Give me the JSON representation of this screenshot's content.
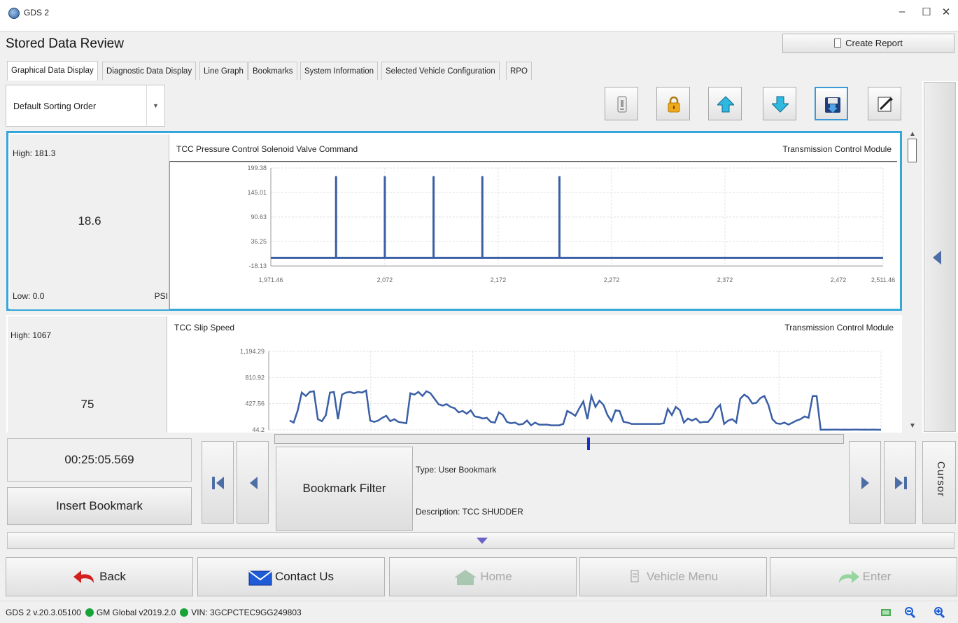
{
  "window": {
    "title": "GDS 2",
    "controls": [
      "–",
      "☐",
      "✕"
    ]
  },
  "header": {
    "title": "Stored Data Review",
    "create_report_label": "Create Report"
  },
  "tabs": [
    {
      "label": "Graphical Data Display",
      "active": true
    },
    {
      "label": "Diagnostic Data Display",
      "active": false
    },
    {
      "label": "Line Graph",
      "active": false
    },
    {
      "label": "Bookmarks",
      "active": false
    },
    {
      "label": "System Information",
      "active": false
    },
    {
      "label": "Selected Vehicle Configuration",
      "active": false
    },
    {
      "label": "RPO",
      "active": false
    }
  ],
  "toolbar": {
    "sort_value": "Default Sorting Order",
    "buttons": [
      "info-icon",
      "lock-icon",
      "arrow-up-icon",
      "arrow-down-icon",
      "save-icon",
      "edit-icon"
    ],
    "selected_button": "save-icon"
  },
  "panels": [
    {
      "high": "High: 181.3",
      "value": "18.6",
      "low": "Low: 0.0",
      "unit": "PSI",
      "title": "TCC Pressure Control Solenoid Valve Command",
      "module": "Transmission Control Module"
    },
    {
      "high": "High: 1067",
      "value": "75",
      "title": "TCC Slip Speed",
      "module": "Transmission Control Module"
    }
  ],
  "chart_data": [
    {
      "type": "line",
      "title": "TCC Pressure Control Solenoid Valve Command",
      "ylabel": "PSI",
      "ylim": [
        -18.13,
        199.38
      ],
      "xlim": [
        1971.46,
        2511.46
      ],
      "y_ticks": [
        "199.38",
        "145.01",
        "90.63",
        "36.25",
        "-18.13"
      ],
      "x_ticks": [
        "1,971.46",
        "2,072",
        "2,172",
        "2,272",
        "2,372",
        "2,472",
        "2,511.46"
      ],
      "grid": true,
      "baseline": 0,
      "spikes": [
        {
          "x": 2029,
          "y": 181.3
        },
        {
          "x": 2072,
          "y": 181.3
        },
        {
          "x": 2115,
          "y": 181.3
        },
        {
          "x": 2158,
          "y": 181.3
        },
        {
          "x": 2226,
          "y": 181.3
        }
      ]
    },
    {
      "type": "line",
      "title": "TCC Slip Speed",
      "ylim": [
        44.2,
        1194.29
      ],
      "y_ticks": [
        "1,194.29",
        "810.92",
        "427.56",
        "44.2"
      ],
      "grid": true,
      "series": [
        {
          "values": [
            180,
            150,
            330,
            590,
            540,
            600,
            610,
            200,
            170,
            260,
            590,
            600,
            200,
            560,
            590,
            600,
            580,
            600,
            590,
            620,
            180,
            160,
            180,
            220,
            250,
            170,
            200,
            160,
            150,
            140,
            580,
            560,
            600,
            540,
            610,
            580,
            500,
            420,
            400,
            420,
            380,
            360,
            300,
            320,
            280,
            330,
            240,
            230,
            210,
            220,
            160,
            150,
            300,
            260,
            160,
            140,
            150,
            120,
            130,
            180,
            110,
            150,
            120,
            120,
            120,
            110,
            110,
            110,
            130,
            320,
            290,
            250,
            360,
            460,
            200,
            540,
            380,
            470,
            410,
            260,
            170,
            330,
            320,
            160,
            150,
            130,
            130,
            130,
            130,
            130,
            130,
            130,
            130,
            140,
            350,
            260,
            380,
            330,
            150,
            210,
            180,
            210,
            150,
            160,
            160,
            230,
            350,
            410,
            130,
            180,
            200,
            150,
            500,
            560,
            520,
            430,
            440,
            510,
            540,
            410,
            200,
            140,
            130,
            150,
            120,
            150,
            180,
            200,
            240,
            220,
            540,
            540,
            44.2,
            46,
            45,
            47,
            46,
            45,
            46,
            45,
            47,
            46,
            45,
            46,
            45,
            46,
            45,
            44.2
          ]
        }
      ]
    }
  ],
  "bookmark": {
    "time": "00:25:05.569",
    "insert_label": "Insert Bookmark",
    "filter_label": "Bookmark Filter",
    "type": "Type:  User Bookmark",
    "description": "Description:  TCC SHUDDER",
    "cursor_label": "Cursor"
  },
  "nav": {
    "back": "Back",
    "contact": "Contact Us",
    "home": "Home",
    "vehicle_menu": "Vehicle Menu",
    "enter": "Enter"
  },
  "status": {
    "version": "GDS 2 v.20.3.05100",
    "global": "GM Global v2019.2.0",
    "vin": "VIN: 3GCPCTEC9GG249803"
  },
  "colors": {
    "accent": "#35a7d8",
    "line": "#3a5fa5",
    "status_green": "#18a338"
  }
}
